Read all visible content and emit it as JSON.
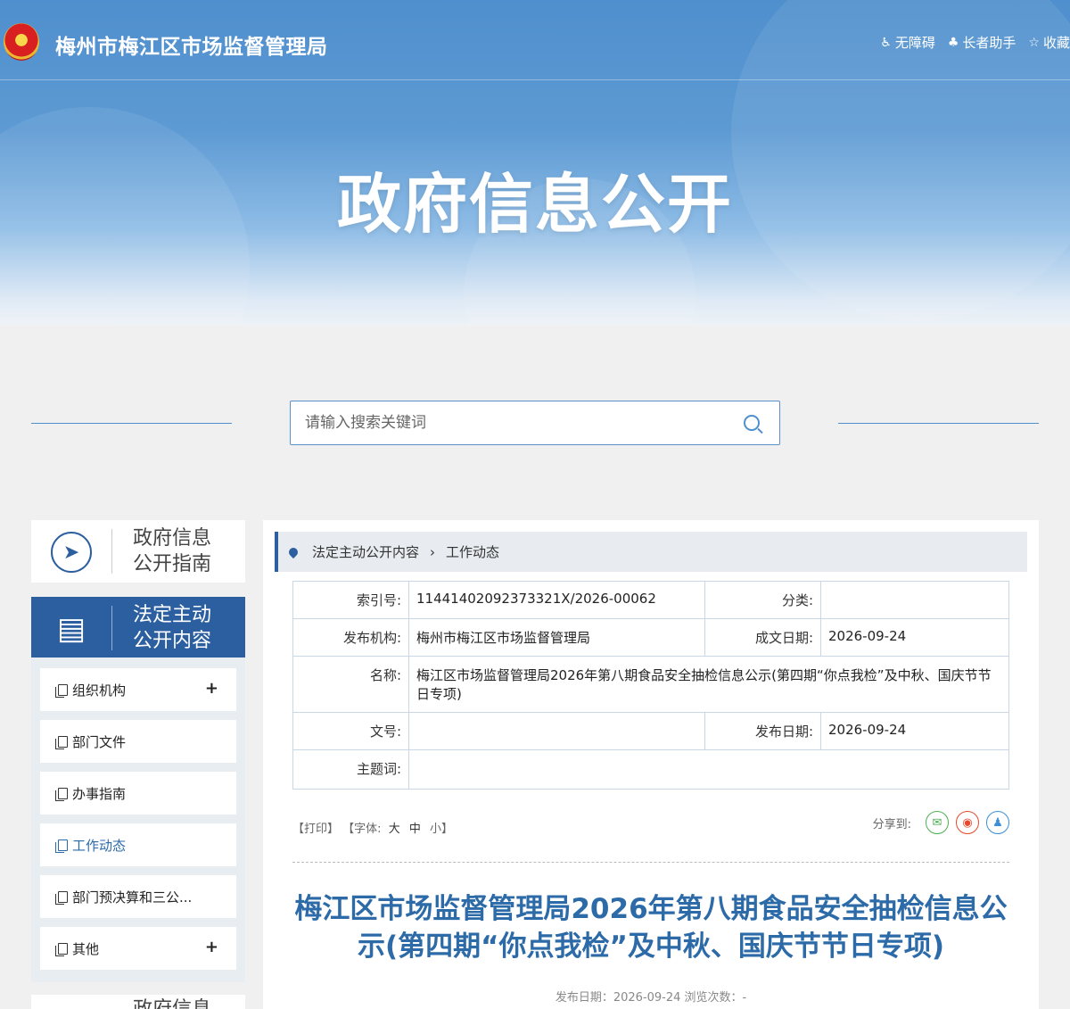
{
  "header": {
    "site_title": "梅州市梅江区市场监督管理局",
    "links": [
      {
        "icon": "accessibility-icon",
        "label": "无障碍"
      },
      {
        "icon": "elder-helper-icon",
        "label": "长者助手"
      },
      {
        "icon": "star-icon",
        "label": "收藏"
      }
    ],
    "banner_title": "政府信息公开"
  },
  "search": {
    "placeholder": "请输入搜索关键词"
  },
  "sidebar": {
    "guide_card": "政府信息\n公开指南",
    "content_card": "法定主动\n公开内容",
    "items": [
      {
        "label": "组织机构",
        "expandable": true
      },
      {
        "label": "部门文件",
        "expandable": false
      },
      {
        "label": "办事指南",
        "expandable": false
      },
      {
        "label": "工作动态",
        "expandable": false,
        "current": true
      },
      {
        "label": "部门预决算和三公...",
        "expandable": false
      },
      {
        "label": "其他",
        "expandable": true
      }
    ],
    "bottom_card": "政府信息"
  },
  "breadcrumb": {
    "root": "法定主动公开内容",
    "current": "工作动态"
  },
  "meta": {
    "index_label": "索引号:",
    "index_value": "11441402092373321X/2026-00062",
    "category_label": "分类:",
    "category_value": "",
    "publisher_label": "发布机构:",
    "publisher_value": "梅州市梅江区市场监督管理局",
    "created_label": "成文日期:",
    "created_value": "2026-09-24",
    "name_label": "名称:",
    "name_value": "梅江区市场监督管理局2026年第八期食品安全抽检信息公示(第四期“你点我检”及中秋、国庆节节日专项)",
    "docno_label": "文号:",
    "docno_value": "",
    "pubdate_label": "发布日期:",
    "pubdate_value": "2026-09-24",
    "keywords_label": "主题词:",
    "keywords_value": ""
  },
  "tools": {
    "print": "【打印】",
    "font_prefix": "【字体:",
    "font_large": "大",
    "font_medium": "中",
    "font_small": "小】",
    "share_label": "分享到:"
  },
  "article": {
    "title": "梅江区市场监督管理局2026年第八期食品安全抽检信息公示(第四期“你点我检”及中秋、国庆节节日专项)",
    "meta_line": "发布日期：2026-09-24   浏览次数：-"
  },
  "colors": {
    "accent": "#2c5fa0",
    "title_blue": "#2c6aa8",
    "wechat": "#4caf50",
    "weibo": "#e6492d",
    "qq": "#3a8fd8"
  }
}
